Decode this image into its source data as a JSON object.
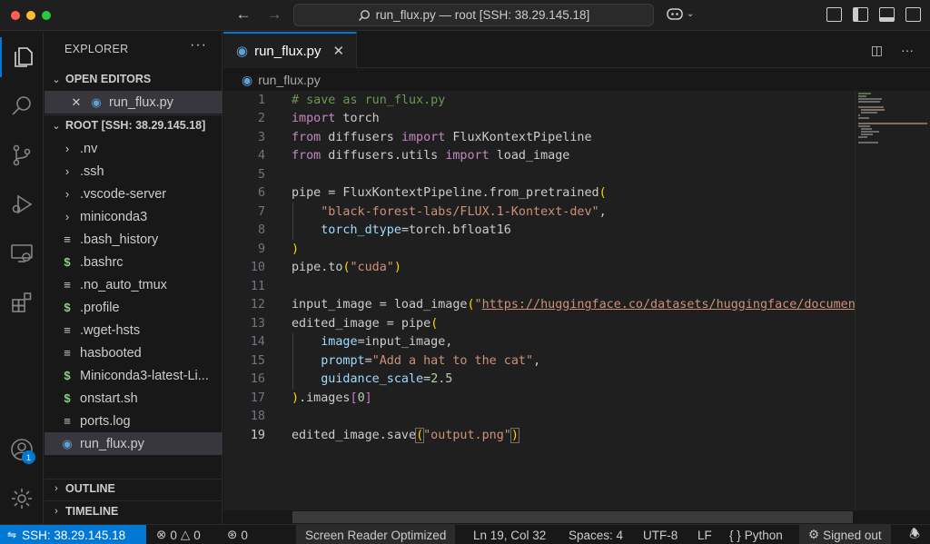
{
  "titlebar": {
    "command_center": "run_flux.py — root [SSH: 38.29.145.18]",
    "traffic_colors": [
      "#ff5f57",
      "#febc2e",
      "#28c840"
    ]
  },
  "activity_bar": {
    "accounts_badge": "1"
  },
  "sidebar": {
    "title": "EXPLORER",
    "more": "···",
    "open_editors_label": "OPEN EDITORS",
    "open_editors": [
      {
        "name": "run_flux.py",
        "icon": "python-icon"
      }
    ],
    "root_label": "ROOT [SSH: 38.29.145.18]",
    "tree": [
      {
        "name": ".nv",
        "icon": "chevron-right-icon"
      },
      {
        "name": ".ssh",
        "icon": "chevron-right-icon"
      },
      {
        "name": ".vscode-server",
        "icon": "chevron-right-icon"
      },
      {
        "name": "miniconda3",
        "icon": "chevron-right-icon"
      },
      {
        "name": ".bash_history",
        "icon": "lines-icon"
      },
      {
        "name": ".bashrc",
        "icon": "dollar-icon"
      },
      {
        "name": ".no_auto_tmux",
        "icon": "lines-icon"
      },
      {
        "name": ".profile",
        "icon": "dollar-icon"
      },
      {
        "name": ".wget-hsts",
        "icon": "lines-icon"
      },
      {
        "name": "hasbooted",
        "icon": "lines-icon"
      },
      {
        "name": "Miniconda3-latest-Li...",
        "icon": "dollar-icon"
      },
      {
        "name": "onstart.sh",
        "icon": "dollar-icon"
      },
      {
        "name": "ports.log",
        "icon": "lines-icon"
      },
      {
        "name": "run_flux.py",
        "icon": "python-icon"
      }
    ],
    "outline_label": "OUTLINE",
    "timeline_label": "TIMELINE"
  },
  "editor": {
    "tab_label": "run_flux.py",
    "breadcrumb": "run_flux.py",
    "line_numbers": [
      "1",
      "2",
      "3",
      "4",
      "5",
      "6",
      "7",
      "8",
      "9",
      "10",
      "11",
      "12",
      "13",
      "14",
      "15",
      "16",
      "17",
      "18",
      "19"
    ],
    "current_line": 19
  },
  "statusbar": {
    "remote": "SSH: 38.29.145.18",
    "errors": "0",
    "warnings": "0",
    "ports": "0",
    "screen_reader": "Screen Reader Optimized",
    "position": "Ln 19, Col 32",
    "spaces": "Spaces: 4",
    "encoding": "UTF-8",
    "eol": "LF",
    "language": "Python",
    "account": "Signed out"
  },
  "colors": {
    "accent": "#0078d4",
    "editor_bg": "#1f1f1f",
    "sidebar_bg": "#181818"
  }
}
